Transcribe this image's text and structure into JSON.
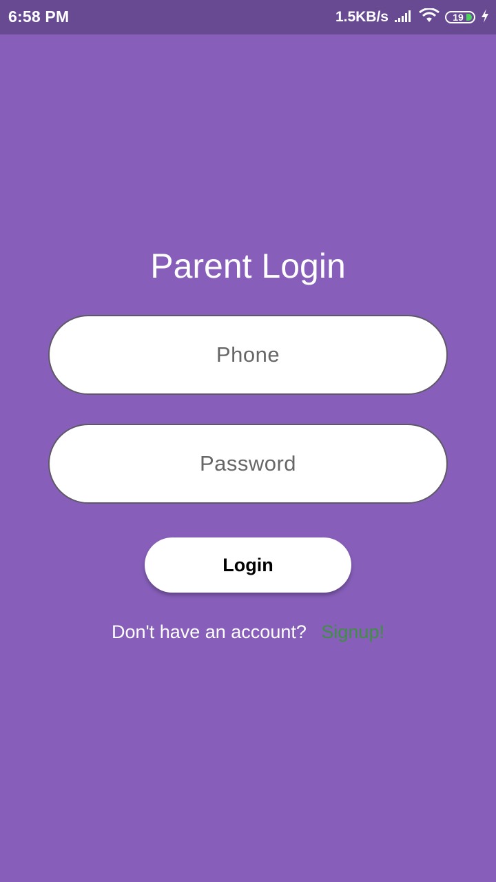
{
  "status_bar": {
    "time": "6:58 PM",
    "net_speed": "1.5KB/s",
    "battery_level": "19",
    "icons": [
      "signal-icon",
      "wifi-icon",
      "battery-icon",
      "charging-icon"
    ]
  },
  "login": {
    "title": "Parent Login",
    "phone_placeholder": "Phone",
    "password_placeholder": "Password",
    "login_label": "Login",
    "signup_prompt": "Don't have an account?",
    "signup_link": "Signup!"
  },
  "colors": {
    "background": "#875fba",
    "status_bar": "#684a93",
    "signup_link": "#3f8f43"
  }
}
